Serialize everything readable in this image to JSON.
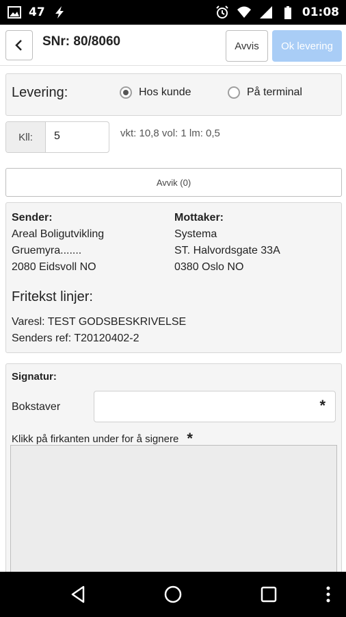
{
  "status_bar": {
    "notification_count": "47",
    "time": "01:08"
  },
  "header": {
    "title": "SNr: 80/8060",
    "avvis_label": "Avvis",
    "ok_label": "Ok levering"
  },
  "levering": {
    "label": "Levering:",
    "options": [
      {
        "label": "Hos kunde",
        "checked": true
      },
      {
        "label": "På terminal",
        "checked": false
      }
    ]
  },
  "kolli": {
    "label": "Kll:",
    "value": "5",
    "info": "vkt: 10,8 vol: 1 lm: 0,5"
  },
  "avvik": {
    "label": "Avvik (0)"
  },
  "sender": {
    "heading": "Sender:",
    "lines": [
      "Areal Boligutvikling",
      "Gruemyra.......",
      "2080 Eidsvoll NO"
    ]
  },
  "mottaker": {
    "heading": "Mottaker:",
    "lines": [
      "Systema",
      "ST. Halvordsgate 33A",
      "0380 Oslo NO"
    ]
  },
  "fritekst": {
    "title": "Fritekst linjer:",
    "lines": [
      "Varesl: TEST GODSBESKRIVELSE",
      "Senders ref: T20120402-2"
    ]
  },
  "signatur": {
    "title": "Signatur:",
    "bokstaver_label": "Bokstaver",
    "required_mark": "*",
    "sign_instruction": "Klikk på firkanten under for å signere"
  },
  "colors": {
    "ok_button": "#a9cdf6",
    "panel_bg": "#f5f5f5",
    "status_bar": "#000000"
  }
}
